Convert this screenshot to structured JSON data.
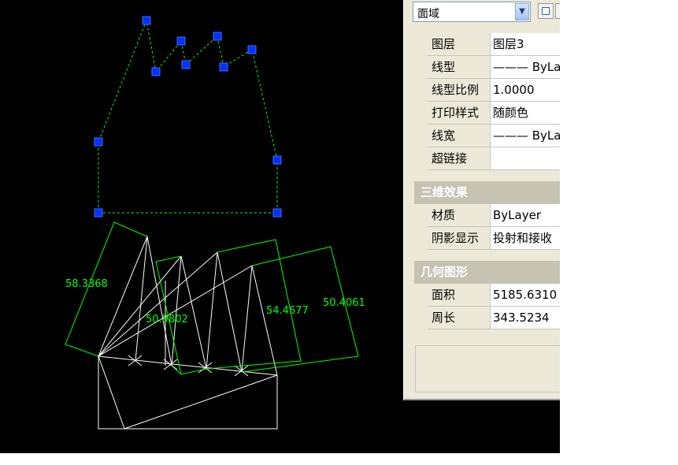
{
  "drawing": {
    "dimensions": [
      "58.3368",
      "50.9802",
      "54.4677",
      "50.4061"
    ]
  },
  "properties": {
    "object_type": "面域",
    "general": [
      {
        "key": "图层",
        "value": "图层3"
      },
      {
        "key": "线型",
        "value": "——— ByLayer"
      },
      {
        "key": "线型比例",
        "value": "1.0000"
      },
      {
        "key": "打印样式",
        "value": "随颜色"
      },
      {
        "key": "线宽",
        "value": "——— ByLayer"
      },
      {
        "key": "超链接",
        "value": ""
      }
    ],
    "section_3d": "三维效果",
    "effects_3d": [
      {
        "key": "材质",
        "value": "ByLayer"
      },
      {
        "key": "阴影显示",
        "value": "投射和接收"
      }
    ],
    "section_geometry": "几何图形",
    "geometry": [
      {
        "key": "面积",
        "value": "5185.6310"
      },
      {
        "key": "周长",
        "value": "343.5234"
      }
    ]
  },
  "colors": {
    "canvas": "#000000",
    "grip": "#0033ff",
    "dimension": "#00ff00",
    "geometry": "#ffffff",
    "panel": "#ece9d8"
  }
}
